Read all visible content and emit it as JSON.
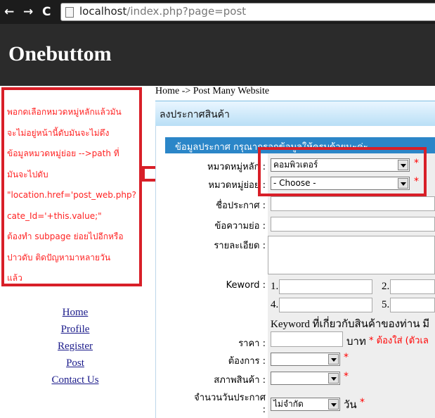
{
  "browser": {
    "back": "←",
    "forward": "→",
    "reload": "C",
    "url_host": "localhost",
    "url_path": "/index.php?page=post"
  },
  "site": {
    "logo": "Onebuttom"
  },
  "note": {
    "lines": [
      "พอกดเลือกหมวดหมู่หลักแล้วมัน",
      "จะไม่อยู่หน้านี้ดับมันจะไม่ดึง",
      "ข้อมูลหมวดหมู่ย่อย   -->path ที่",
      "มันจะไปดับ",
      "\"location.href='post_web.php?",
      "cate_Id='+this.value;\"",
      "ต้องทำ subpage ย่อยไปอีกหรือ",
      "ปาวดับ   ติดปัญหามาหลายวัน",
      "แล้ว"
    ]
  },
  "menu": [
    "Home",
    "Profile",
    "Register",
    "Post",
    "Contact Us"
  ],
  "breadcrumb": "Home -> Post Many Website",
  "panel": {
    "title": "ลงประกาศสินค้า",
    "section": "ข้อมูลประกาศ กรุณากรอกข้อมูลให้ครบด้วยนะค่ะ"
  },
  "form": {
    "main_category_label": "หมวดหมู่หลัก :",
    "main_category_value": "คอมพิวเตอร์",
    "sub_category_label": "หมวดหมู่ย่อย :",
    "sub_category_value": "- Choose -",
    "title_label": "ชื่อประกาศ :",
    "summary_label": "ข้อความย่อ :",
    "detail_label": "รายละเอียด :",
    "keyword_label": "Keword :",
    "keyword_nums": [
      "1.",
      "2.",
      "4.",
      "5."
    ],
    "keyword_hint": "Keyword ที่เกี่ยวกับสินค้าของท่าน มี",
    "price_label": "ราคา :",
    "price_unit": "บาท",
    "price_required": "* ต้องใส่ (ตัวเล",
    "want_label": "ต้องการ :",
    "condition_label": "สภาพสินค้า :",
    "days_label": "จำนวนวันประกาศ",
    "days_label_colon": ":",
    "days_value": "ไม่จำกัด",
    "days_unit": "วัน",
    "required_mark": "*"
  }
}
